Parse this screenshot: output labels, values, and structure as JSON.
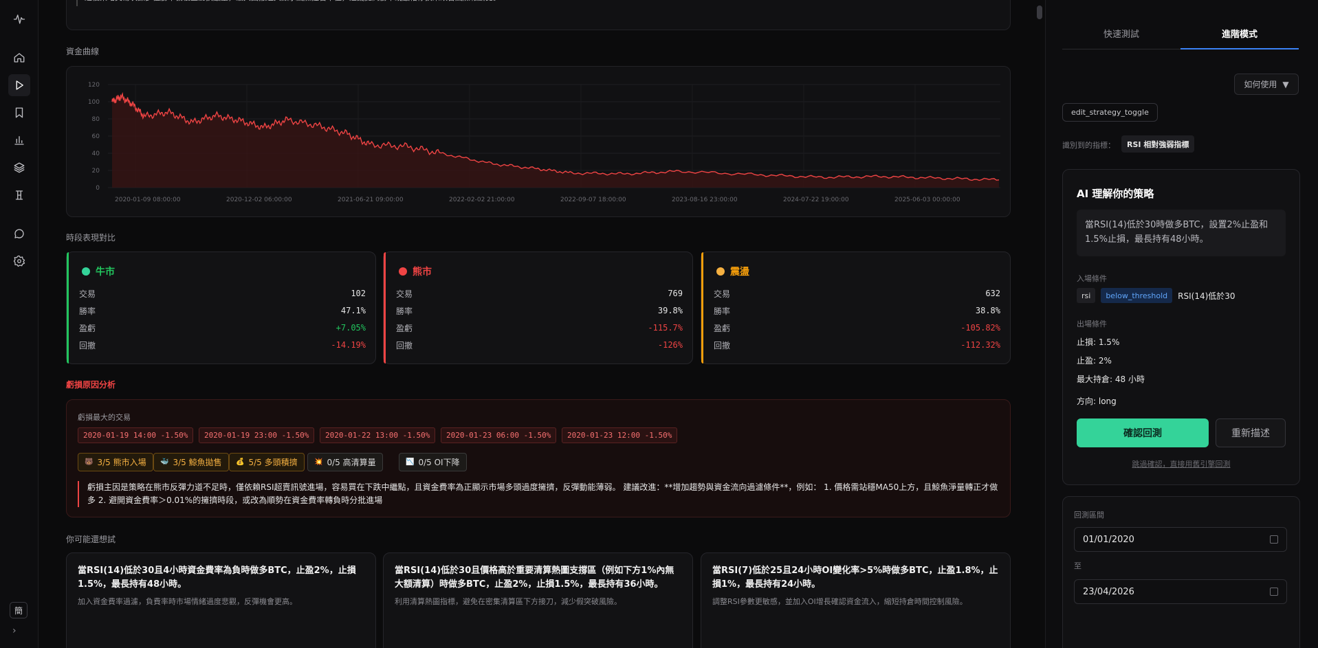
{
  "banner": {
    "text": "這個策略交易次數多但勝率偏低且虧損嚴重，最大回撤過大顯示風險控管不佳，建議提高勝率或嚴格停損來改善風險報酬比。"
  },
  "equity": {
    "section_label": "資金曲線",
    "chart_data": {
      "type": "area",
      "title": "",
      "xlabel": "",
      "ylabel": "",
      "ylim": [
        0,
        120
      ],
      "yticks": [
        0,
        20,
        40,
        60,
        80,
        100,
        120
      ],
      "xtick_labels": [
        "2020-01-09 08:00:00",
        "2020-12-02 06:00:00",
        "2021-06-21 09:00:00",
        "2022-02-02 21:00:00",
        "2022-09-07 18:00:00",
        "2023-08-16 23:00:00",
        "2024-07-22 19:00:00",
        "2025-06-03 00:00:00"
      ],
      "series": [
        {
          "color": "#ef4444",
          "x": [
            "2020-01-09",
            "2020-02-01",
            "2020-03-01",
            "2020-04-01",
            "2020-06-01",
            "2020-08-01",
            "2020-10-01",
            "2020-12-02",
            "2021-02-01",
            "2021-04-01",
            "2021-06-21",
            "2021-09-01",
            "2021-11-01",
            "2022-02-02",
            "2022-05-01",
            "2022-09-07",
            "2023-01-01",
            "2023-04-01",
            "2023-08-16",
            "2024-01-01",
            "2024-07-22",
            "2025-01-01",
            "2025-06-03",
            "2025-11-01",
            "2026-04-01"
          ],
          "y": [
            100,
            106,
            97,
            83,
            88,
            76,
            84,
            78,
            70,
            79,
            72,
            63,
            50,
            48,
            40,
            28,
            22,
            17,
            16,
            19,
            15,
            12,
            13,
            11,
            9
          ]
        }
      ],
      "grid": true,
      "colors": {
        "line": "#ef4444",
        "fill": "#3a1414"
      }
    }
  },
  "regimes": {
    "section_label": "時段表現對比",
    "cards": [
      {
        "name": "牛市",
        "color": "#22c55e",
        "dot": "#34d399",
        "rows": [
          {
            "k": "交易",
            "v": "102",
            "c": "#e6e6e6"
          },
          {
            "k": "勝率",
            "v": "47.1%",
            "c": "#e6e6e6"
          },
          {
            "k": "盈虧",
            "v": "+7.05%",
            "c": "#22c55e"
          },
          {
            "k": "回撤",
            "v": "-14.19%",
            "c": "#ef4444"
          }
        ]
      },
      {
        "name": "熊市",
        "color": "#ef4444",
        "dot": "#ef4444",
        "rows": [
          {
            "k": "交易",
            "v": "769",
            "c": "#e6e6e6"
          },
          {
            "k": "勝率",
            "v": "39.8%",
            "c": "#e6e6e6"
          },
          {
            "k": "盈虧",
            "v": "-115.7%",
            "c": "#ef4444"
          },
          {
            "k": "回撤",
            "v": "-126%",
            "c": "#ef4444"
          }
        ]
      },
      {
        "name": "震盪",
        "color": "#f59e0b",
        "dot": "#f5b041",
        "rows": [
          {
            "k": "交易",
            "v": "632",
            "c": "#e6e6e6"
          },
          {
            "k": "勝率",
            "v": "38.8%",
            "c": "#e6e6e6"
          },
          {
            "k": "盈虧",
            "v": "-105.82%",
            "c": "#ef4444"
          },
          {
            "k": "回撤",
            "v": "-112.32%",
            "c": "#ef4444"
          }
        ]
      }
    ]
  },
  "loss": {
    "title": "虧損原因分析",
    "sub": "虧損最大的交易",
    "trades": [
      "2020-01-19 14:00 -1.50%",
      "2020-01-19 23:00 -1.50%",
      "2020-01-22 13:00 -1.50%",
      "2020-01-23 06:00 -1.50%",
      "2020-01-23 12:00 -1.50%"
    ],
    "factors": [
      {
        "icon": "🐻",
        "text": "3/5 熊市入場"
      },
      {
        "icon": "🐳",
        "text": "3/5 鯨魚拋售"
      },
      {
        "icon": "💰",
        "text": "5/5 多頭積擠"
      },
      {
        "icon": "💥",
        "text": "0/5 高清算量"
      },
      {
        "icon": "📉",
        "text": "0/5 OI下降"
      }
    ],
    "note": "虧損主因是策略在熊市反彈力道不足時，僅依賴RSI超賣訊號進場，容易買在下跌中繼點，且資金費率為正顯示市場多頭過度擁擠，反彈動能薄弱。 建議改進：**增加趨勢與資金流向過濾條件**，例如： 1. 價格需站穩MA50上方，且鯨魚淨量轉正才做多 2. 避開資金費率＞0.01%的擁擠時段，或改為順勢在資金費率轉負時分批進場"
  },
  "suggestions": {
    "title": "你可能還想試",
    "items": [
      {
        "title": "當RSI(14)低於30且4小時資金費率為負時做多BTC，止盈2%，止損1.5%，最長持有48小時。",
        "desc": "加入資金費率過濾，負費率時市場情緒過度悲觀，反彈機會更高。"
      },
      {
        "title": "當RSI(14)低於30且價格高於重要清算熱圖支撐區（例如下方1%內無大額清算）時做多BTC，止盈2%，止損1.5%，最長持有36小時。",
        "desc": "利用清算熱圖指標，避免在密集清算區下方接刀，減少假突破風險。"
      },
      {
        "title": "當RSI(7)低於25且24小時OI變化率>5%時做多BTC，止盈1.8%，止損1%，最長持有24小時。",
        "desc": "調整RSI參數更敏感，並加入OI增長確認資金流入，縮短持倉時間控制風險。"
      }
    ]
  },
  "panel": {
    "tabs": [
      "快速測試",
      "進階模式"
    ],
    "howto": "如何使用",
    "edit_toggle": "edit_strategy_toggle",
    "detected_label": "識別到的指標：",
    "detected_value": "RSI 相對強弱指標",
    "ai_title": "AI 理解你的策略",
    "ai_summary": "當RSI(14)低於30時做多BTC，設置2%止盈和1.5%止損，最長持有48小時。",
    "entry_label": "入場條件",
    "entry_tags": [
      "rsi",
      "below_threshold"
    ],
    "entry_desc": "RSI(14)低於30",
    "exit_label": "出場條件",
    "exit_lines": [
      "止損: 1.5%",
      "止盈: 2%",
      "最大持倉: 48 小時"
    ],
    "direction": "方向: long",
    "confirm": "確認回測",
    "redescribe": "重新描述",
    "skip": "跳過確認，直接用舊引擎回測",
    "range_label": "回測區間",
    "start_date": "01/01/2020",
    "to_label": "至",
    "end_date": "23/04/2026"
  },
  "sidebar": {
    "lang": "簡",
    "expand": "›"
  }
}
